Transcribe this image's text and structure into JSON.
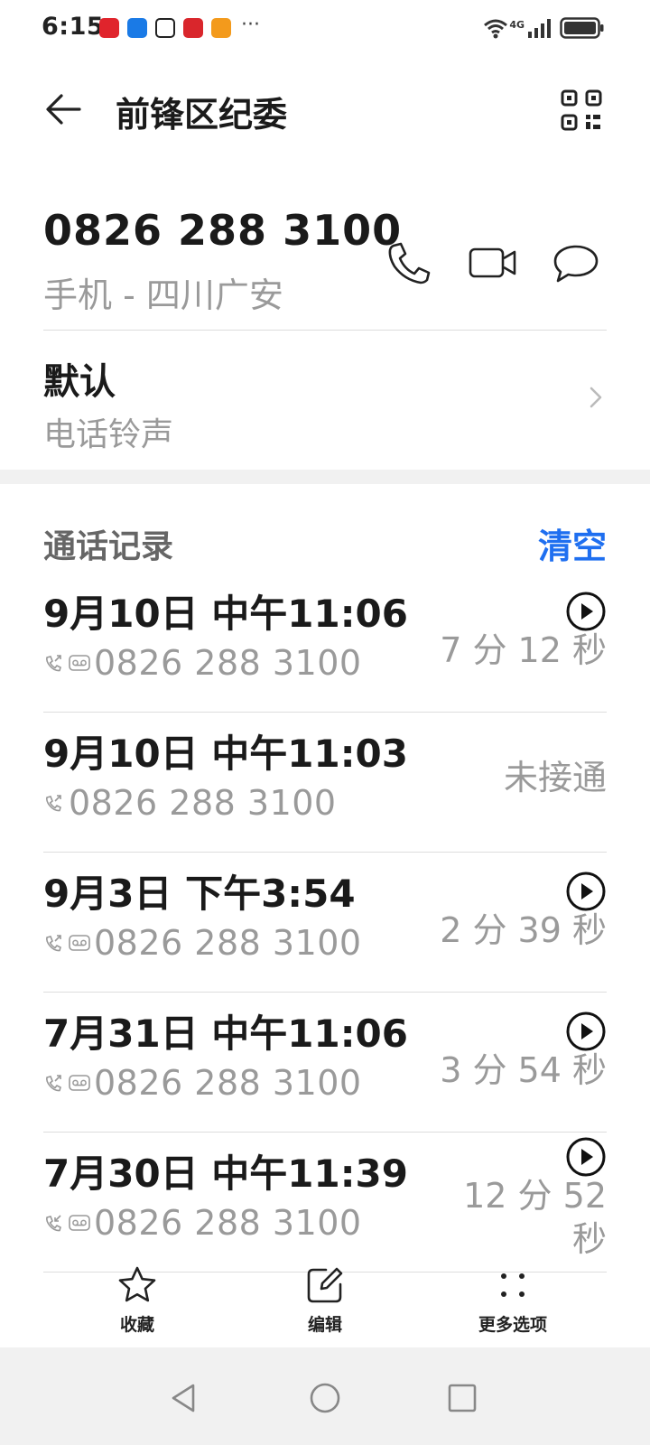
{
  "status_bar": {
    "time": "6:15",
    "network": "4G",
    "more": "···",
    "app_icons": [
      "#e0242c",
      "#1a7ae6",
      "#222222",
      "#d9262c",
      "#f39a1c"
    ]
  },
  "header": {
    "title": "前锋区纪委"
  },
  "contact": {
    "number": "0826 288 3100",
    "subtitle": "手机 - 四川广安"
  },
  "ringtone": {
    "value": "默认",
    "label": "电话铃声"
  },
  "call_log": {
    "title": "通话记录",
    "clear_label": "清空",
    "accent_color": "#1f6ff0",
    "entries": [
      {
        "date": "9月10日 中午11:06",
        "number": "0826 288 3100",
        "duration": "7 分 12 秒",
        "type": "outgoing",
        "recorded": true
      },
      {
        "date": "9月10日 中午11:03",
        "number": "0826 288 3100",
        "duration": "未接通",
        "type": "outgoing",
        "recorded": false
      },
      {
        "date": "9月3日 下午3:54",
        "number": "0826 288 3100",
        "duration": "2 分 39 秒",
        "type": "outgoing",
        "recorded": true
      },
      {
        "date": "7月31日 中午11:06",
        "number": "0826 288 3100",
        "duration": "3 分 54 秒",
        "type": "outgoing",
        "recorded": true
      },
      {
        "date": "7月30日 中午11:39",
        "number": "0826 288 3100",
        "duration": "12 分 52 秒",
        "type": "incoming",
        "recorded": true
      }
    ]
  },
  "toolbar": {
    "favorite_label": "收藏",
    "edit_label": "编辑",
    "more_label": "更多选项"
  },
  "icons": {
    "back": "arrow-left-icon",
    "qr": "qr-code-icon",
    "call": "phone-icon",
    "video": "video-camera-icon",
    "message": "message-bubble-icon",
    "play": "play-circle-icon",
    "favorite": "star-icon",
    "edit": "edit-icon",
    "more": "more-dots-icon"
  }
}
